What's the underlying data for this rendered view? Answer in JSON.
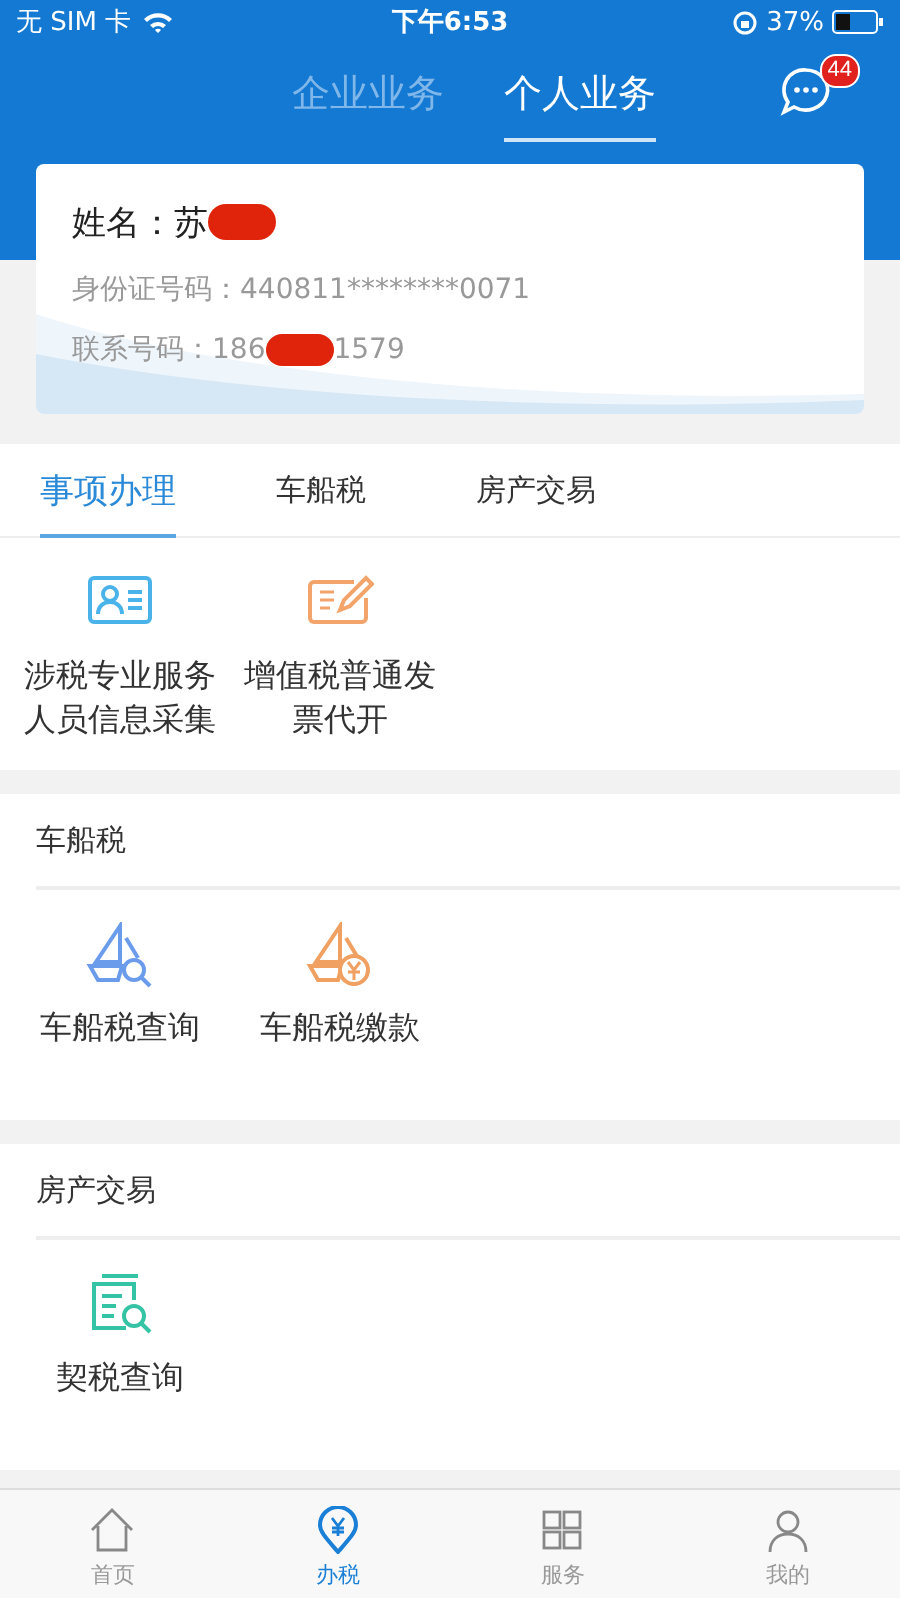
{
  "status_bar": {
    "carrier": "无 SIM 卡",
    "time": "下午6:53",
    "battery": "37%"
  },
  "header": {
    "tabs": [
      {
        "label": "企业业务",
        "selected": false
      },
      {
        "label": "个人业务",
        "selected": true
      }
    ],
    "message_badge": "44"
  },
  "profile": {
    "name_label": "姓名：",
    "name": "苏",
    "name_redacted": true,
    "id_label": "身份证号码：",
    "id_number": "440811********0071",
    "phone_label": "联系号码：",
    "phone_prefix": "186",
    "phone_redacted": true,
    "phone_suffix": "1579"
  },
  "category_tabs": [
    {
      "label": "事项办理",
      "selected": true
    },
    {
      "label": "车船税",
      "selected": false
    },
    {
      "label": "房产交易",
      "selected": false
    }
  ],
  "first_panel": {
    "items": [
      {
        "label": "涉税专业服务人员信息采集",
        "kind": "id-card",
        "color": "#4ab3ea"
      },
      {
        "label": "增值税普通发票代开",
        "kind": "invoice",
        "color": "#f2a46a"
      }
    ]
  },
  "sections": [
    {
      "title": "车船税",
      "items": [
        {
          "label": "车船税查询",
          "kind": "boat-search",
          "color": "#6b9cec"
        },
        {
          "label": "车船税缴款",
          "kind": "boat-pay",
          "color": "#f0a060"
        }
      ]
    },
    {
      "title": "房产交易",
      "items": [
        {
          "label": "契税查询",
          "kind": "doc-search",
          "color": "#35c3a5"
        }
      ]
    }
  ],
  "bottom_nav": [
    {
      "label": "首页",
      "kind": "home",
      "selected": false
    },
    {
      "label": "办税",
      "kind": "tax",
      "selected": true
    },
    {
      "label": "服务",
      "kind": "service",
      "selected": false
    },
    {
      "label": "我的",
      "kind": "profile",
      "selected": false
    }
  ]
}
